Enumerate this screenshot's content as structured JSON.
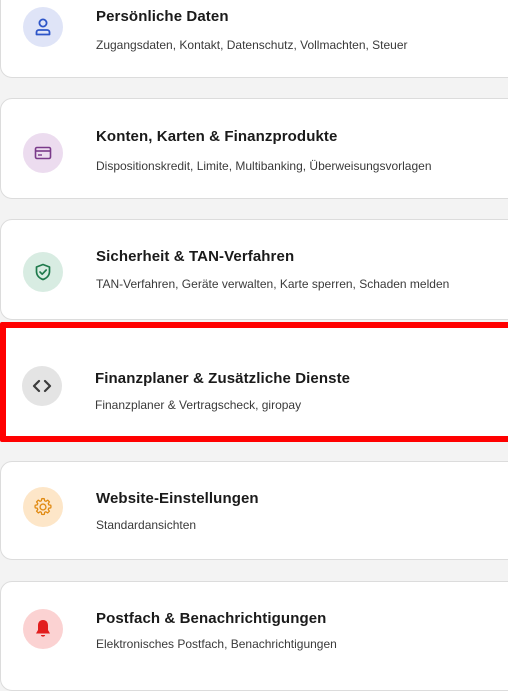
{
  "menu": {
    "items": [
      {
        "title": "Persönliche Daten",
        "subtitle": "Zugangsdaten, Kontakt, Datenschutz, Vollmachten, Steuer",
        "icon": "person-icon",
        "icon_bg": "#dfe4f7",
        "icon_color": "#2d55c8"
      },
      {
        "title": "Konten, Karten & Finanzprodukte",
        "subtitle": "Dispositionskredit, Limite, Multibanking, Überweisungsvorlagen",
        "icon": "card-icon",
        "icon_bg": "#ecdcef",
        "icon_color": "#7a3a8a"
      },
      {
        "title": "Sicherheit & TAN-Verfahren",
        "subtitle": "TAN-Verfahren, Geräte verwalten, Karte sperren, Schaden melden",
        "icon": "shield-check-icon",
        "icon_bg": "#d8ece2",
        "icon_color": "#1f7a4c"
      },
      {
        "title": "Finanzplaner & Zusätzliche Dienste",
        "subtitle": "Finanzplaner & Vertragscheck, giropay",
        "icon": "code-brackets-icon",
        "icon_bg": "#e4e4e4",
        "icon_color": "#3c3c3c"
      },
      {
        "title": "Website-Einstellungen",
        "subtitle": "Standardansichten",
        "icon": "gear-icon",
        "icon_bg": "#fde6c8",
        "icon_color": "#e08a12"
      },
      {
        "title": "Postfach & Benachrichtigungen",
        "subtitle": "Elektronisches Postfach, Benachrichtigungen",
        "icon": "bell-icon",
        "icon_bg": "#fbd2d2",
        "icon_color": "#e21e1e"
      }
    ],
    "highlight_color": "#ff0000"
  }
}
